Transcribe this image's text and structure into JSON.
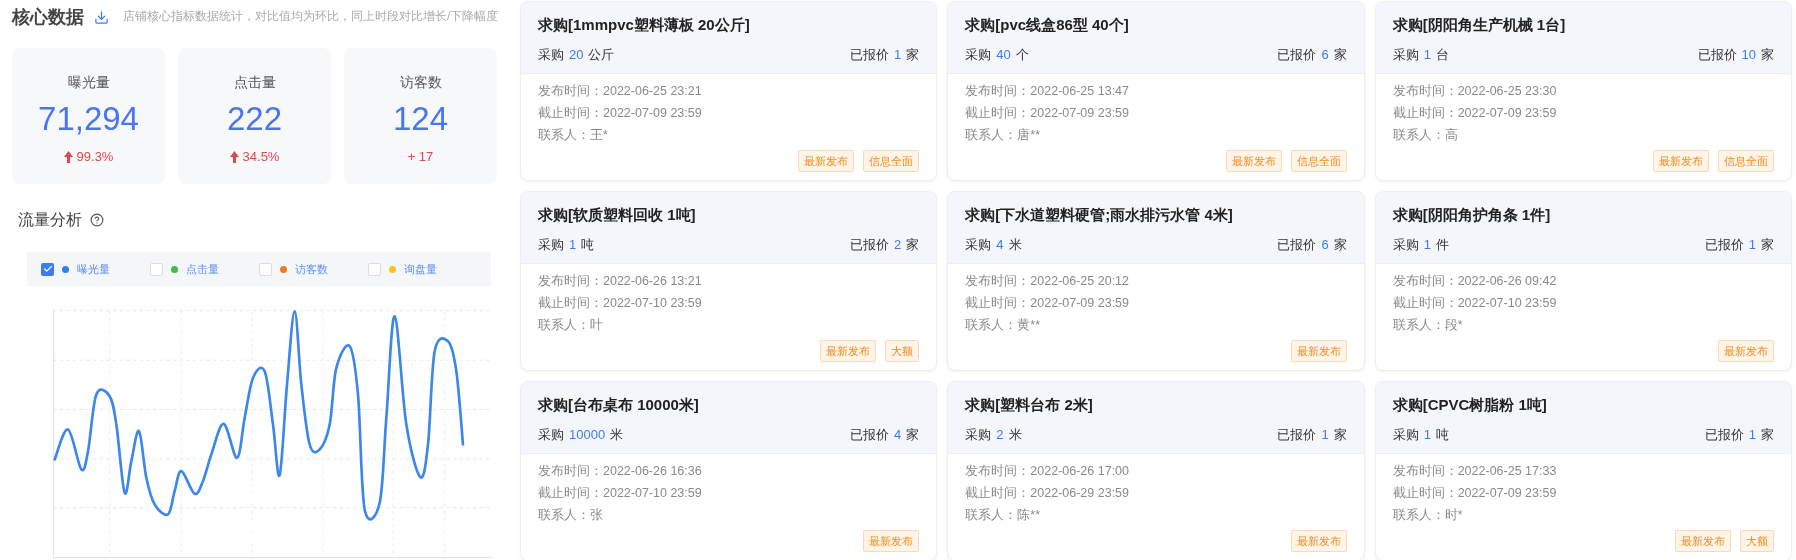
{
  "core": {
    "title": "核心数据",
    "subtitle": "店铺核心指标数据统计，对比值均为环比，同上时段对比增长/下降幅度",
    "stats": [
      {
        "label": "曝光量",
        "value": "71,294",
        "change": "99.3%",
        "arrow": true
      },
      {
        "label": "点击量",
        "value": "222",
        "change": "34.5%",
        "arrow": true
      },
      {
        "label": "访客数",
        "value": "124",
        "change": "+ 17",
        "arrow": false
      }
    ]
  },
  "traffic": {
    "title": "流量分析",
    "legend": [
      {
        "label": "曝光量",
        "checked": true,
        "color": "#2f80ed"
      },
      {
        "label": "点击量",
        "checked": false,
        "color": "#3dbb4e"
      },
      {
        "label": "访客数",
        "checked": false,
        "color": "#ee7a22"
      },
      {
        "label": "询盘量",
        "checked": false,
        "color": "#f5c323"
      }
    ]
  },
  "cards": [
    {
      "title": "求购[1mmpvc塑料薄板 20公斤]",
      "buy_label": "采购",
      "qty": "20",
      "unit": "公斤",
      "quote_label": "已报价",
      "quotes": "1",
      "quote_unit": "家",
      "lines": [
        "发布时间：2022-06-25 23:21",
        "截止时间：2022-07-09 23:59",
        "联系人：王*"
      ],
      "tags": [
        "最新发布",
        "信息全面"
      ]
    },
    {
      "title": "求购[pvc线盒86型 40个]",
      "buy_label": "采购",
      "qty": "40",
      "unit": "个",
      "quote_label": "已报价",
      "quotes": "6",
      "quote_unit": "家",
      "lines": [
        "发布时间：2022-06-25 13:47",
        "截止时间：2022-07-09 23:59",
        "联系人：唐**"
      ],
      "tags": [
        "最新发布",
        "信息全面"
      ]
    },
    {
      "title": "求购[阴阳角生产机械 1台]",
      "buy_label": "采购",
      "qty": "1",
      "unit": "台",
      "quote_label": "已报价",
      "quotes": "10",
      "quote_unit": "家",
      "lines": [
        "发布时间：2022-06-25 23:30",
        "截止时间：2022-07-09 23:59",
        "联系人：高"
      ],
      "tags": [
        "最新发布",
        "信息全面"
      ]
    },
    {
      "title": "求购[软质塑料回收 1吨]",
      "buy_label": "采购",
      "qty": "1",
      "unit": "吨",
      "quote_label": "已报价",
      "quotes": "2",
      "quote_unit": "家",
      "lines": [
        "发布时间：2022-06-26 13:21",
        "截止时间：2022-07-10 23:59",
        "联系人：叶"
      ],
      "tags": [
        "最新发布",
        "大额"
      ]
    },
    {
      "title": "求购[下水道塑料硬管;雨水排污水管 4米]",
      "buy_label": "采购",
      "qty": "4",
      "unit": "米",
      "quote_label": "已报价",
      "quotes": "6",
      "quote_unit": "家",
      "lines": [
        "发布时间：2022-06-25 20:12",
        "截止时间：2022-07-09 23:59",
        "联系人：黄**"
      ],
      "tags": [
        "最新发布"
      ]
    },
    {
      "title": "求购[阴阳角护角条 1件]",
      "buy_label": "采购",
      "qty": "1",
      "unit": "件",
      "quote_label": "已报价",
      "quotes": "1",
      "quote_unit": "家",
      "lines": [
        "发布时间：2022-06-26 09:42",
        "截止时间：2022-07-10 23:59",
        "联系人：段*"
      ],
      "tags": [
        "最新发布"
      ]
    },
    {
      "title": "求购[台布桌布 10000米]",
      "buy_label": "采购",
      "qty": "10000",
      "unit": "米",
      "quote_label": "已报价",
      "quotes": "4",
      "quote_unit": "家",
      "lines": [
        "发布时间：2022-06-26 16:36",
        "截止时间：2022-07-10 23:59",
        "联系人：张"
      ],
      "tags": [
        "最新发布"
      ]
    },
    {
      "title": "求购[塑料台布 2米]",
      "buy_label": "采购",
      "qty": "2",
      "unit": "米",
      "quote_label": "已报价",
      "quotes": "1",
      "quote_unit": "家",
      "lines": [
        "发布时间：2022-06-26 17:00",
        "截止时间：2022-06-29 23:59",
        "联系人：陈**"
      ],
      "tags": [
        "最新发布"
      ]
    },
    {
      "title": "求购[CPVC树脂粉 1吨]",
      "buy_label": "采购",
      "qty": "1",
      "unit": "吨",
      "quote_label": "已报价",
      "quotes": "1",
      "quote_unit": "家",
      "lines": [
        "发布时间：2022-06-25 17:33",
        "截止时间：2022-07-09 23:59",
        "联系人：时*"
      ],
      "tags": [
        "最新发布",
        "大额"
      ]
    }
  ]
}
